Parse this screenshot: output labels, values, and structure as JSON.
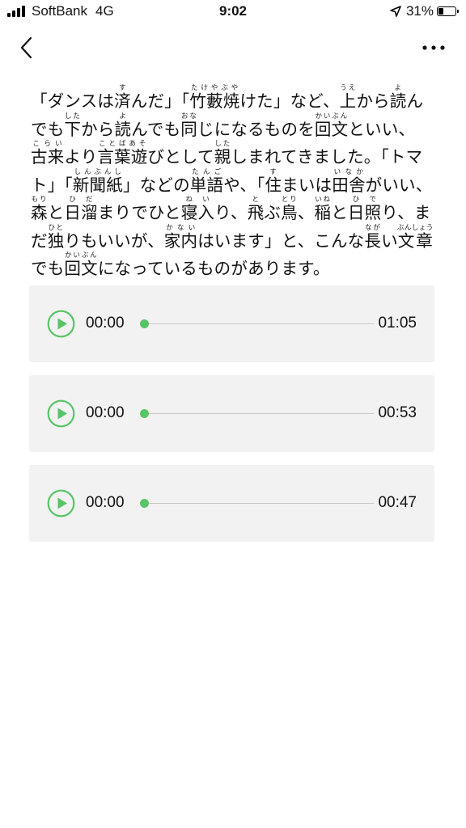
{
  "status_bar": {
    "carrier": "SoftBank",
    "network": "4G",
    "time": "9:02",
    "battery": "31%",
    "battery_level": 0.31
  },
  "nav": {
    "back_icon": "chevron-left-icon",
    "more_icon": "more-dots-icon"
  },
  "article": {
    "segments": [
      {
        "t": "「ダンスは"
      },
      {
        "b": "済",
        "r": "す"
      },
      {
        "t": "んだ」「"
      },
      {
        "b": "竹藪焼",
        "r": "たけやぶや"
      },
      {
        "t": "けた」など、"
      },
      {
        "b": "上",
        "r": "うえ"
      },
      {
        "t": "から"
      },
      {
        "b": "読",
        "r": "よ"
      },
      {
        "t": "んでも"
      },
      {
        "b": "下",
        "r": "した"
      },
      {
        "t": "から"
      },
      {
        "b": "読",
        "r": "よ"
      },
      {
        "t": "んでも"
      },
      {
        "b": "同",
        "r": "おな"
      },
      {
        "t": "じになるものを"
      },
      {
        "b": "回文",
        "r": "かいぶん"
      },
      {
        "t": "といい、"
      },
      {
        "b": "古来",
        "r": "こらい"
      },
      {
        "t": "より"
      },
      {
        "b": "言葉遊",
        "r": "ことばあそ"
      },
      {
        "t": "びとして"
      },
      {
        "b": "親",
        "r": "した"
      },
      {
        "t": "しまれてきました。「トマト」「"
      },
      {
        "b": "新聞紙",
        "r": "しんぶんし"
      },
      {
        "t": "」などの"
      },
      {
        "b": "単語",
        "r": "たんご"
      },
      {
        "t": "や、「"
      },
      {
        "b": "住",
        "r": "す"
      },
      {
        "t": "まいは"
      },
      {
        "b": "田舎",
        "r": "いなか"
      },
      {
        "t": "がいい、"
      },
      {
        "b": "森",
        "r": "もり"
      },
      {
        "t": "と"
      },
      {
        "b": "日溜",
        "r": "ひだ"
      },
      {
        "t": "まりでひと"
      },
      {
        "b": "寝入",
        "r": "ねい"
      },
      {
        "t": "り、"
      },
      {
        "b": "飛",
        "r": "と"
      },
      {
        "t": "ぶ"
      },
      {
        "b": "鳥",
        "r": "とり"
      },
      {
        "t": "、"
      },
      {
        "b": "稲",
        "r": "いね"
      },
      {
        "t": "と"
      },
      {
        "b": "日照",
        "r": "ひで"
      },
      {
        "t": "り、まだ"
      },
      {
        "b": "独",
        "r": "ひと"
      },
      {
        "t": "りもいいが、"
      },
      {
        "b": "家内",
        "r": "かない"
      },
      {
        "t": "はいます」と、こんな"
      },
      {
        "b": "長",
        "r": "なが"
      },
      {
        "t": "い"
      },
      {
        "b": "文章",
        "r": "ぶんしょう"
      },
      {
        "t": "でも"
      },
      {
        "b": "回文",
        "r": "かいぶん"
      },
      {
        "t": "になっているものがあります。"
      }
    ]
  },
  "audio_tracks": [
    {
      "current": "00:00",
      "total": "01:05",
      "progress": 0
    },
    {
      "current": "00:00",
      "total": "00:53",
      "progress": 0
    },
    {
      "current": "00:00",
      "total": "00:47",
      "progress": 0
    }
  ],
  "colors": {
    "accent": "#57c566",
    "card_bg": "#f2f2f2",
    "track": "#c8c8c8"
  }
}
